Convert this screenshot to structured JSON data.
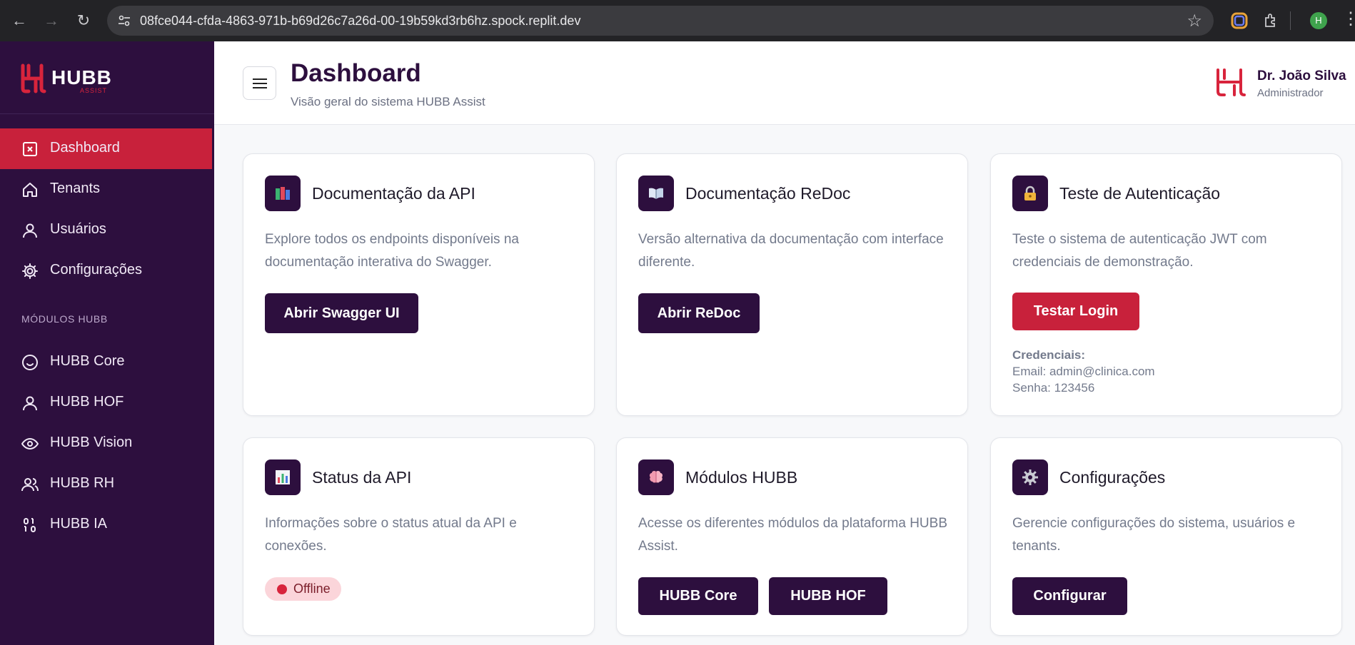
{
  "browser": {
    "url": "08fce044-cfda-4863-971b-b69d26c7a26d-00-19b59kd3rb6hz.spock.replit.dev",
    "profile_initial": "H"
  },
  "brand": {
    "logo_text": "HUBB",
    "logo_sub": "ASSIST"
  },
  "sidebar": {
    "items": [
      {
        "label": "Dashboard",
        "icon": "dashboard-icon",
        "active": true
      },
      {
        "label": "Tenants",
        "icon": "home-icon"
      },
      {
        "label": "Usuários",
        "icon": "user-icon"
      },
      {
        "label": "Configurações",
        "icon": "gear-icon"
      }
    ],
    "section_label": "MÓDULOS HUBB",
    "modules": [
      {
        "label": "HUBB Core",
        "icon": "smile-icon"
      },
      {
        "label": "HUBB HOF",
        "icon": "user-icon"
      },
      {
        "label": "HUBB Vision",
        "icon": "eye-icon"
      },
      {
        "label": "HUBB RH",
        "icon": "users-icon"
      },
      {
        "label": "HUBB IA",
        "icon": "binary-icon"
      }
    ]
  },
  "header": {
    "title": "Dashboard",
    "subtitle": "Visão geral do sistema HUBB Assist",
    "user_name": "Dr. João Silva",
    "user_role": "Administrador"
  },
  "cards": {
    "api_docs": {
      "title": "Documentação da API",
      "description": "Explore todos os endpoints disponíveis na documentação interativa do Swagger.",
      "button": "Abrir Swagger UI",
      "icon": "books-icon"
    },
    "redoc": {
      "title": "Documentação ReDoc",
      "description": "Versão alternativa da documentação com interface diferente.",
      "button": "Abrir ReDoc",
      "icon": "open-book-icon"
    },
    "auth": {
      "title": "Teste de Autenticação",
      "description": "Teste o sistema de autenticação JWT com credenciais de demonstração.",
      "button": "Testar Login",
      "icon": "lock-icon",
      "cred_label": "Credenciais:",
      "cred_email": "Email: admin@clinica.com",
      "cred_password": "Senha: 123456"
    },
    "status": {
      "title": "Status da API",
      "description": "Informações sobre o status atual da API e conexões.",
      "badge": "Offline",
      "icon": "bar-chart-icon"
    },
    "modules": {
      "title": "Módulos HUBB",
      "description": "Acesse os diferentes módulos da plataforma HUBB Assist.",
      "button_core": "HUBB Core",
      "button_hof": "HUBB HOF",
      "icon": "brain-icon"
    },
    "settings": {
      "title": "Configurações",
      "description": "Gerencie configurações do sistema, usuários e tenants.",
      "button": "Configurar",
      "icon": "gear-icon"
    }
  },
  "colors": {
    "primary": "#2d0f3e",
    "accent": "#c8213b",
    "background": "#f7f8fa"
  }
}
